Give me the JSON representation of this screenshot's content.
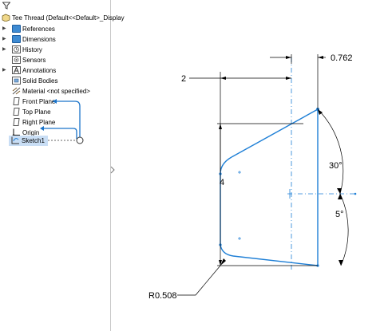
{
  "tree": {
    "root_label": "Tee Thread  (Default<<Default>_Display",
    "items": [
      {
        "label": "References",
        "icon": "folder-icon",
        "expandable": true
      },
      {
        "label": "Dimensions",
        "icon": "folder-icon",
        "expandable": true
      },
      {
        "label": "History",
        "icon": "history-icon",
        "expandable": true
      },
      {
        "label": "Sensors",
        "icon": "sensor-icon",
        "expandable": false
      },
      {
        "label": "Annotations",
        "icon": "annotations-icon",
        "expandable": true
      },
      {
        "label": "Solid Bodies",
        "icon": "solid-bodies-icon",
        "expandable": false
      },
      {
        "label": "Material <not specified>",
        "icon": "material-icon",
        "expandable": false
      },
      {
        "label": "Front Plane",
        "icon": "plane-icon",
        "expandable": false
      },
      {
        "label": "Top Plane",
        "icon": "plane-icon",
        "expandable": false
      },
      {
        "label": "Right Plane",
        "icon": "plane-icon",
        "expandable": false
      },
      {
        "label": "Origin",
        "icon": "origin-icon",
        "expandable": false
      },
      {
        "label": "Sketch1",
        "icon": "sketch-icon",
        "expandable": false,
        "selected": true
      }
    ]
  },
  "sketch": {
    "dimensions": {
      "top_width": "2",
      "offset": "0.762",
      "height": "4",
      "angle_top": "30°",
      "angle_bottom": "5°",
      "radius": "R0.508"
    },
    "colors": {
      "geometry": "#1e7fd6",
      "dimension": "#000000",
      "selection": "#c9def5",
      "relation": "#1a73c9"
    }
  }
}
